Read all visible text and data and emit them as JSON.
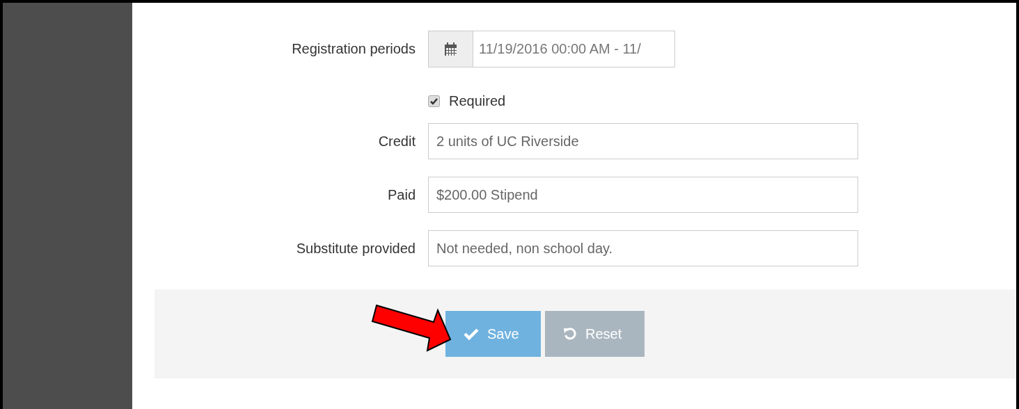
{
  "form": {
    "fields": [
      {
        "kind": "date",
        "label": "Registration periods",
        "value": "11/19/2016 00:00 AM - 11/"
      },
      {
        "kind": "checkbox",
        "label": "Required",
        "checked": true
      },
      {
        "kind": "text",
        "label": "Credit",
        "value": "2 units of UC Riverside"
      },
      {
        "kind": "text",
        "label": "Paid",
        "value": "$200.00 Stipend"
      },
      {
        "kind": "text",
        "label": "Substitute provided",
        "value": "Not needed, non school day."
      }
    ]
  },
  "buttons": [
    {
      "kind": "save",
      "label": "Save"
    },
    {
      "kind": "reset",
      "label": "Reset"
    }
  ]
}
